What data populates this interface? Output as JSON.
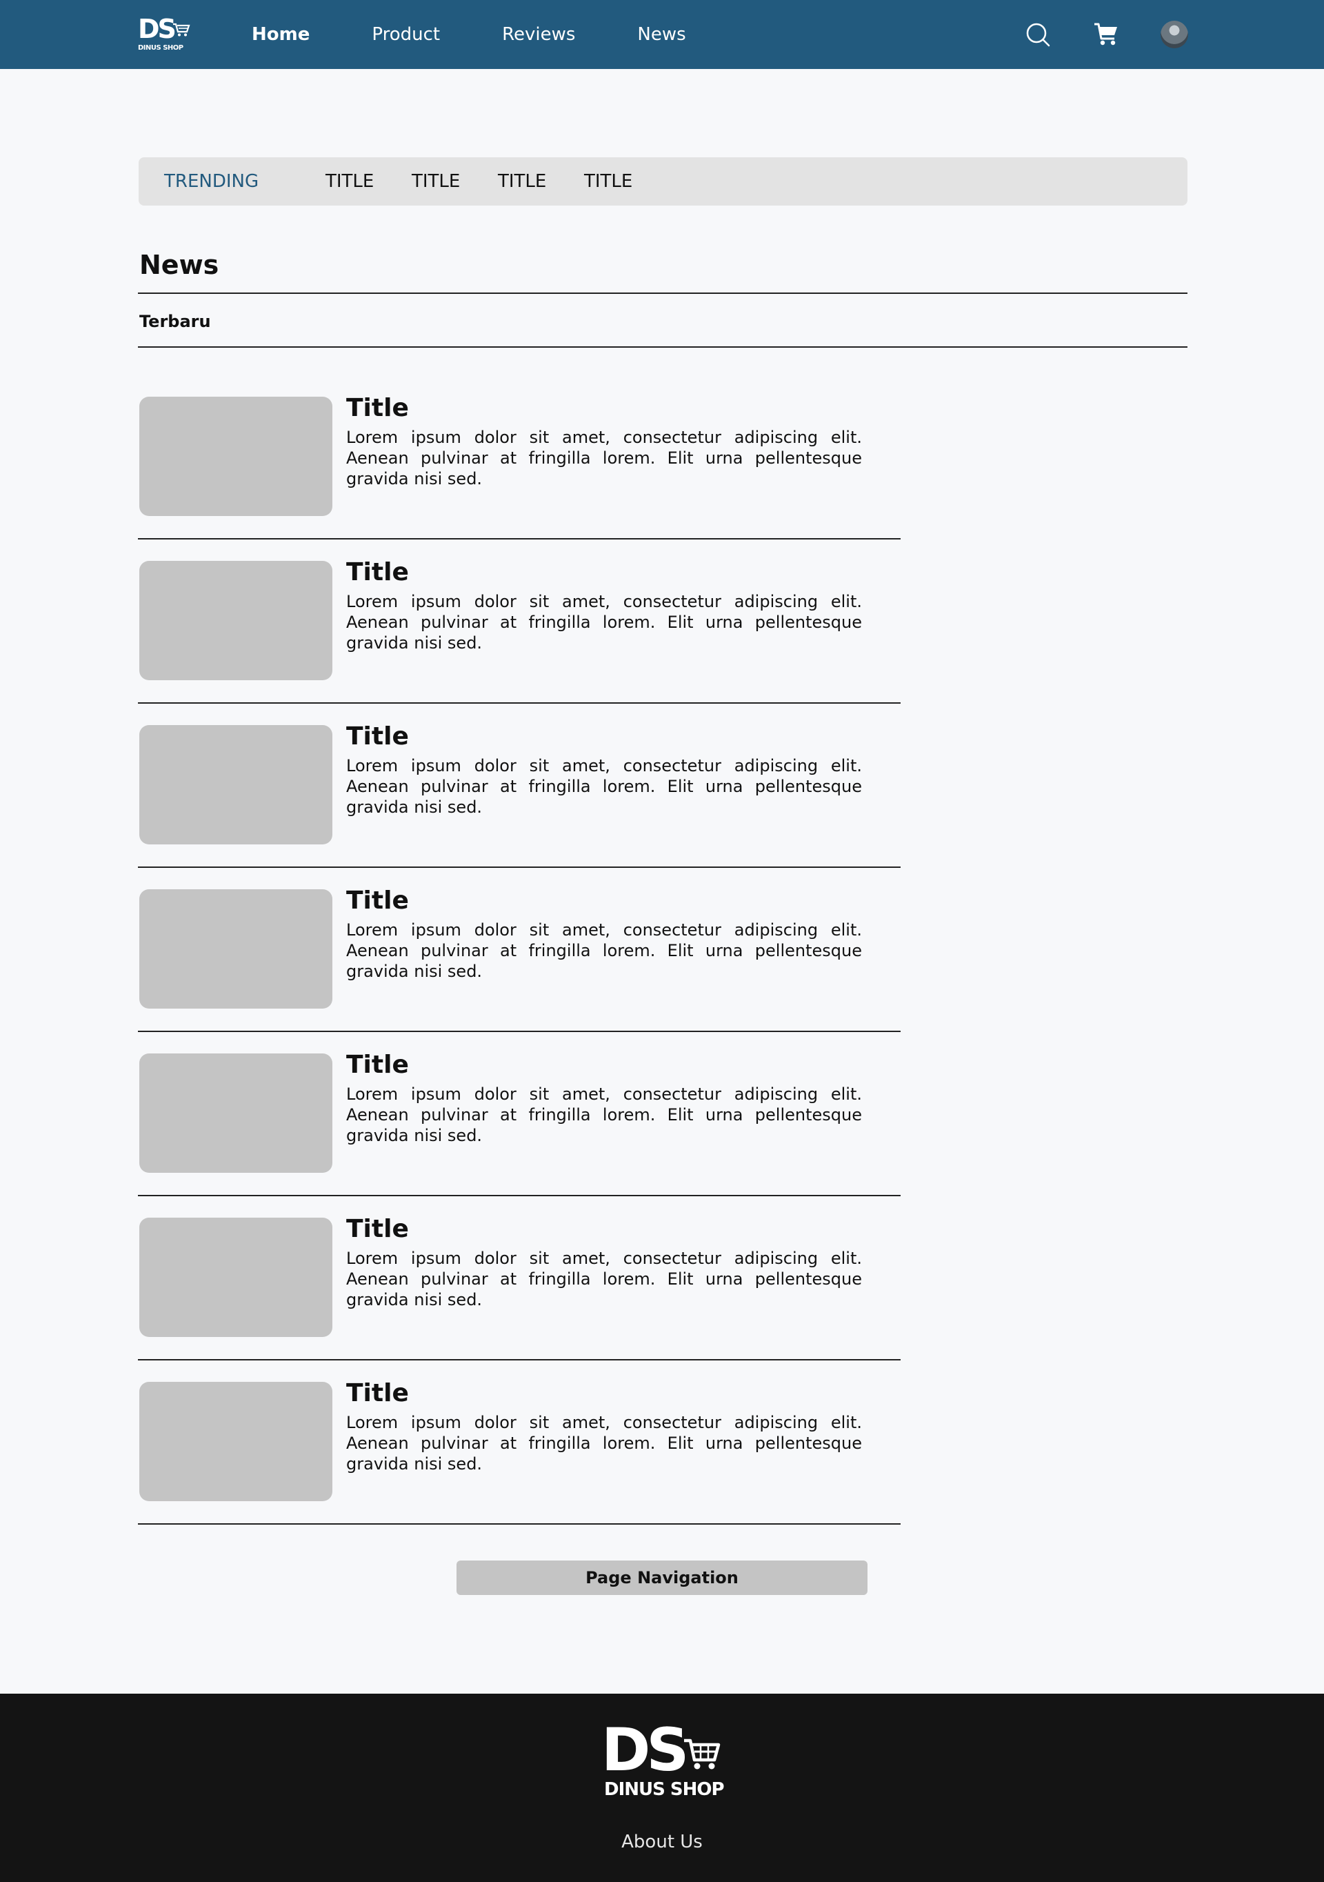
{
  "brand": {
    "logo_main": "DS",
    "logo_sub": "DINUS SHOP"
  },
  "nav": {
    "items": [
      {
        "label": "Home",
        "active": true
      },
      {
        "label": "Product",
        "active": false
      },
      {
        "label": "Reviews",
        "active": false
      },
      {
        "label": "News",
        "active": false
      }
    ]
  },
  "header_icons": [
    "search-icon",
    "cart-icon",
    "avatar"
  ],
  "trending": {
    "label": "TRENDING",
    "items": [
      "TITLE",
      "TITLE",
      "TITLE",
      "TITLE"
    ]
  },
  "news": {
    "title": "News",
    "filter": "Terbaru",
    "articles": [
      {
        "title": "Title",
        "body": "Lorem ipsum dolor sit amet, consectetur adipiscing elit. Aenean pulvinar at fringilla lorem. Elit urna pellentesque gravida nisi sed."
      },
      {
        "title": "Title",
        "body": "Lorem ipsum dolor sit amet, consectetur adipiscing elit. Aenean pulvinar at fringilla lorem. Elit urna pellentesque gravida nisi sed."
      },
      {
        "title": "Title",
        "body": "Lorem ipsum dolor sit amet, consectetur adipiscing elit. Aenean pulvinar at fringilla lorem. Elit urna pellentesque gravida nisi sed."
      },
      {
        "title": "Title",
        "body": "Lorem ipsum dolor sit amet, consectetur adipiscing elit. Aenean pulvinar at fringilla lorem. Elit urna pellentesque gravida nisi sed."
      },
      {
        "title": "Title",
        "body": "Lorem ipsum dolor sit amet, consectetur adipiscing elit. Aenean pulvinar at fringilla lorem. Elit urna pellentesque gravida nisi sed."
      },
      {
        "title": "Title",
        "body": "Lorem ipsum dolor sit amet, consectetur adipiscing elit. Aenean pulvinar at fringilla lorem. Elit urna pellentesque gravida nisi sed."
      },
      {
        "title": "Title",
        "body": "Lorem ipsum dolor sit amet, consectetur adipiscing elit. Aenean pulvinar at fringilla lorem. Elit urna pellentesque gravida nisi sed."
      }
    ]
  },
  "pagination": {
    "label": "Page Navigation"
  },
  "footer": {
    "logo_main": "DS",
    "logo_sub": "DINUS SHOP",
    "about_label": "About Us"
  },
  "colors": {
    "header_bg": "#225a7e",
    "accent": "#225a7e",
    "page_bg": "#f7f8fa",
    "trending_bg": "#e3e3e3",
    "placeholder": "#c4c4c4",
    "footer_bg": "#141414"
  }
}
